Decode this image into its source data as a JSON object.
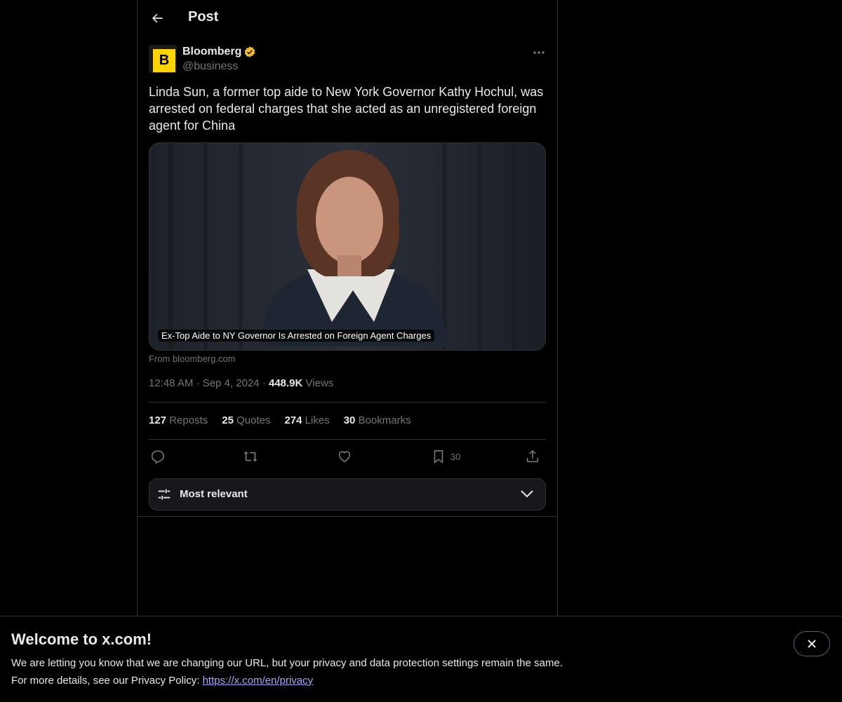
{
  "header": {
    "title": "Post"
  },
  "author": {
    "name": "Bloomberg",
    "handle": "@business",
    "avatar_letter": "B",
    "verified": true
  },
  "post": {
    "text": "Linda Sun, a former top aide to New York Governor Kathy Hochul, was arrested on federal charges that she acted as an unregistered foreign agent for China",
    "media_caption": "Ex-Top Aide to NY Governor Is Arrested on Foreign Agent Charges",
    "source": "From bloomberg.com",
    "time": "12:48 AM",
    "date": "Sep 4, 2024",
    "views_count": "448.9K",
    "views_label": "Views"
  },
  "stats": {
    "reposts_count": "127",
    "reposts_label": "Reposts",
    "quotes_count": "25",
    "quotes_label": "Quotes",
    "likes_count": "274",
    "likes_label": "Likes",
    "bookmarks_count": "30",
    "bookmarks_label": "Bookmarks"
  },
  "actions": {
    "bookmark_count": "30"
  },
  "sort": {
    "label": "Most relevant"
  },
  "banner": {
    "title": "Welcome to x.com!",
    "line1": "We are letting you know that we are changing our URL, but your privacy and data protection settings remain the same.",
    "line2_prefix": "For more details, see our Privacy Policy: ",
    "link": "https://x.com/en/privacy"
  },
  "colors": {
    "accent_gold": "#f4bc2c",
    "text_muted": "#71767b",
    "link": "#a4a9f5"
  }
}
